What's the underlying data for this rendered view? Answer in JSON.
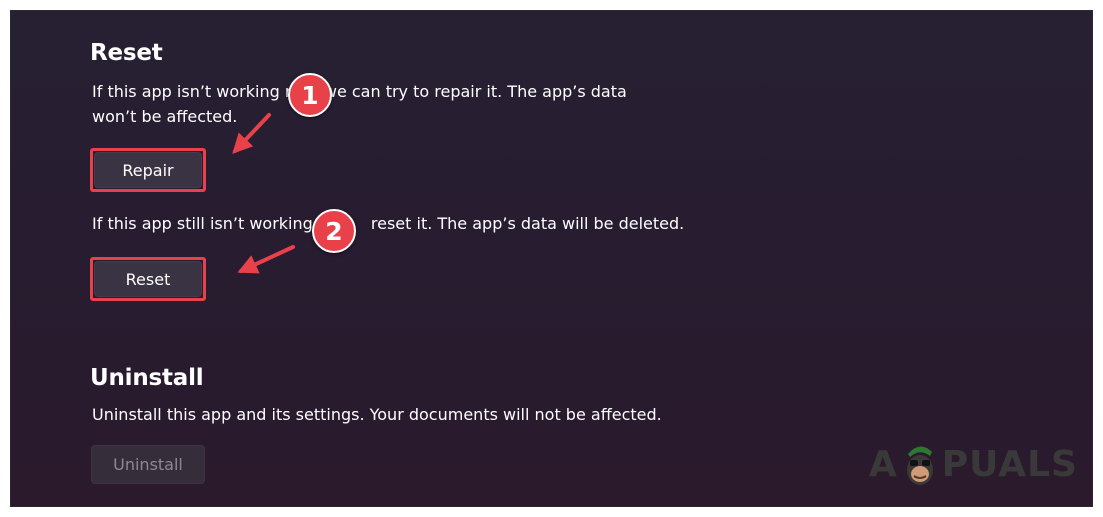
{
  "reset_section": {
    "heading": "Reset",
    "repair_description": "If this app isn’t working right, we can try to repair it. The app’s data won’t be affected.",
    "repair_description_line1": "If this app isn’t working ri",
    "repair_description_line1_rest": "we can try to repair it. The app’s data",
    "repair_description_line2": "won’t be affected.",
    "repair_button_label": "Repair",
    "reset_description_part1": "If this app still isn’t working ri",
    "reset_description_part2": "reset it. The app’s data will be deleted.",
    "reset_button_label": "Reset"
  },
  "uninstall_section": {
    "heading": "Uninstall",
    "description": "Uninstall this app and its settings. Your documents will not be affected.",
    "button_label": "Uninstall",
    "button_disabled": true
  },
  "annotations": {
    "step1_number": "1",
    "step2_number": "2",
    "highlight_color": "#e8414a"
  },
  "watermark": {
    "text_left": "A",
    "text_right": "PUALS"
  },
  "colors": {
    "background": "#271c30",
    "button": "#3a3343",
    "text": "#ffffff",
    "disabled_text": "#8e8894"
  }
}
